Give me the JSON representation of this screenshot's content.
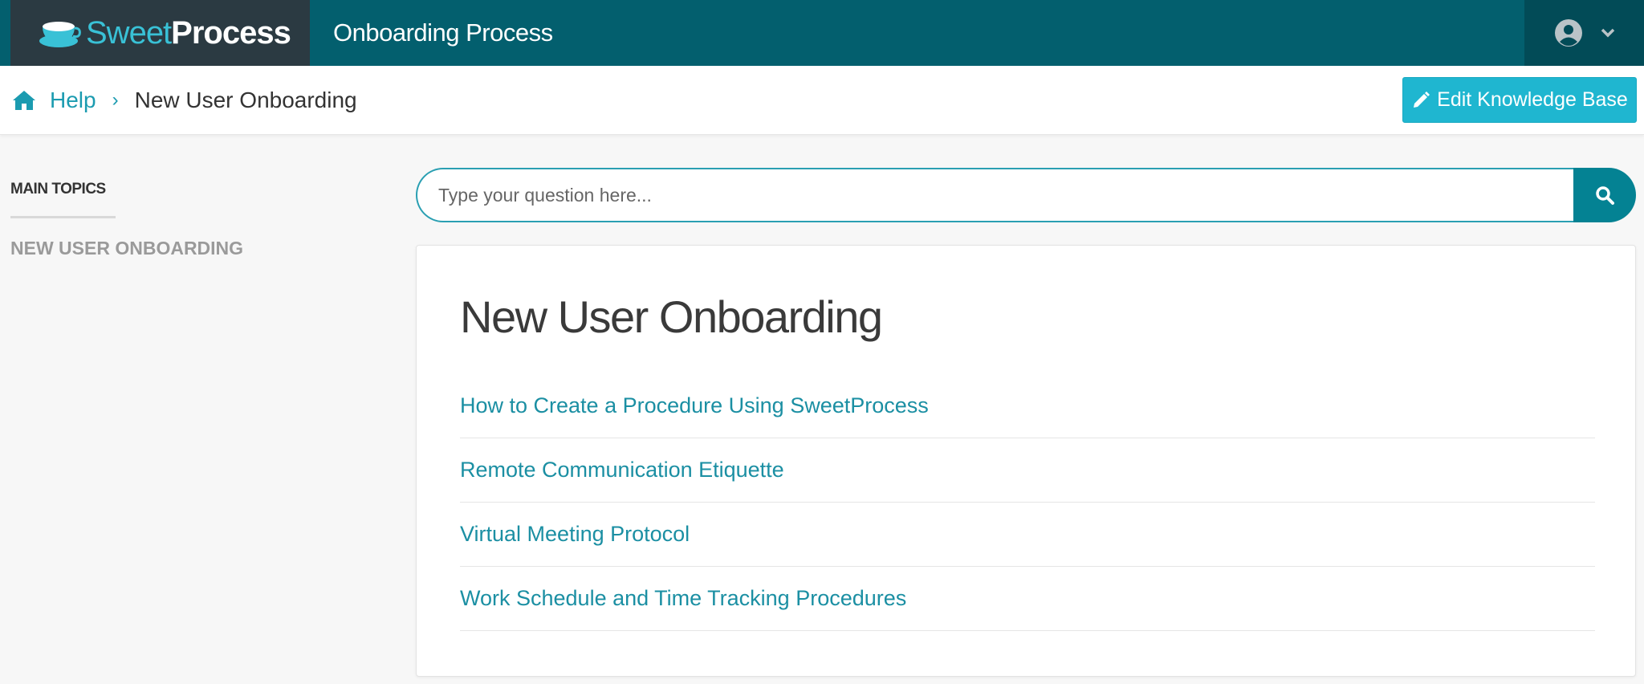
{
  "brand": {
    "sweet": "Sweet",
    "process": "Process",
    "logo_icon": "teacup-icon"
  },
  "header": {
    "title": "Onboarding Process",
    "user_icon": "user-circle-icon",
    "menu_icon": "chevron-down-icon"
  },
  "breadcrumb": {
    "home_label": "Help",
    "current": "New User Onboarding",
    "separator": "›"
  },
  "toolbar": {
    "edit_label": "Edit Knowledge Base"
  },
  "sidebar": {
    "heading": "MAIN TOPICS",
    "items": [
      {
        "label": "NEW USER ONBOARDING"
      }
    ]
  },
  "search": {
    "placeholder": "Type your question here...",
    "value": ""
  },
  "main": {
    "title": "New User Onboarding",
    "articles": [
      {
        "label": "How to Create a Procedure Using SweetProcess"
      },
      {
        "label": "Remote Communication Etiquette"
      },
      {
        "label": "Virtual Meeting Protocol"
      },
      {
        "label": "Work Schedule and Time Tracking Procedures"
      }
    ]
  },
  "colors": {
    "topbar": "#035f6e",
    "logo_bg": "#2b3a42",
    "accent": "#1fb6d0",
    "link": "#1b8fa3"
  }
}
